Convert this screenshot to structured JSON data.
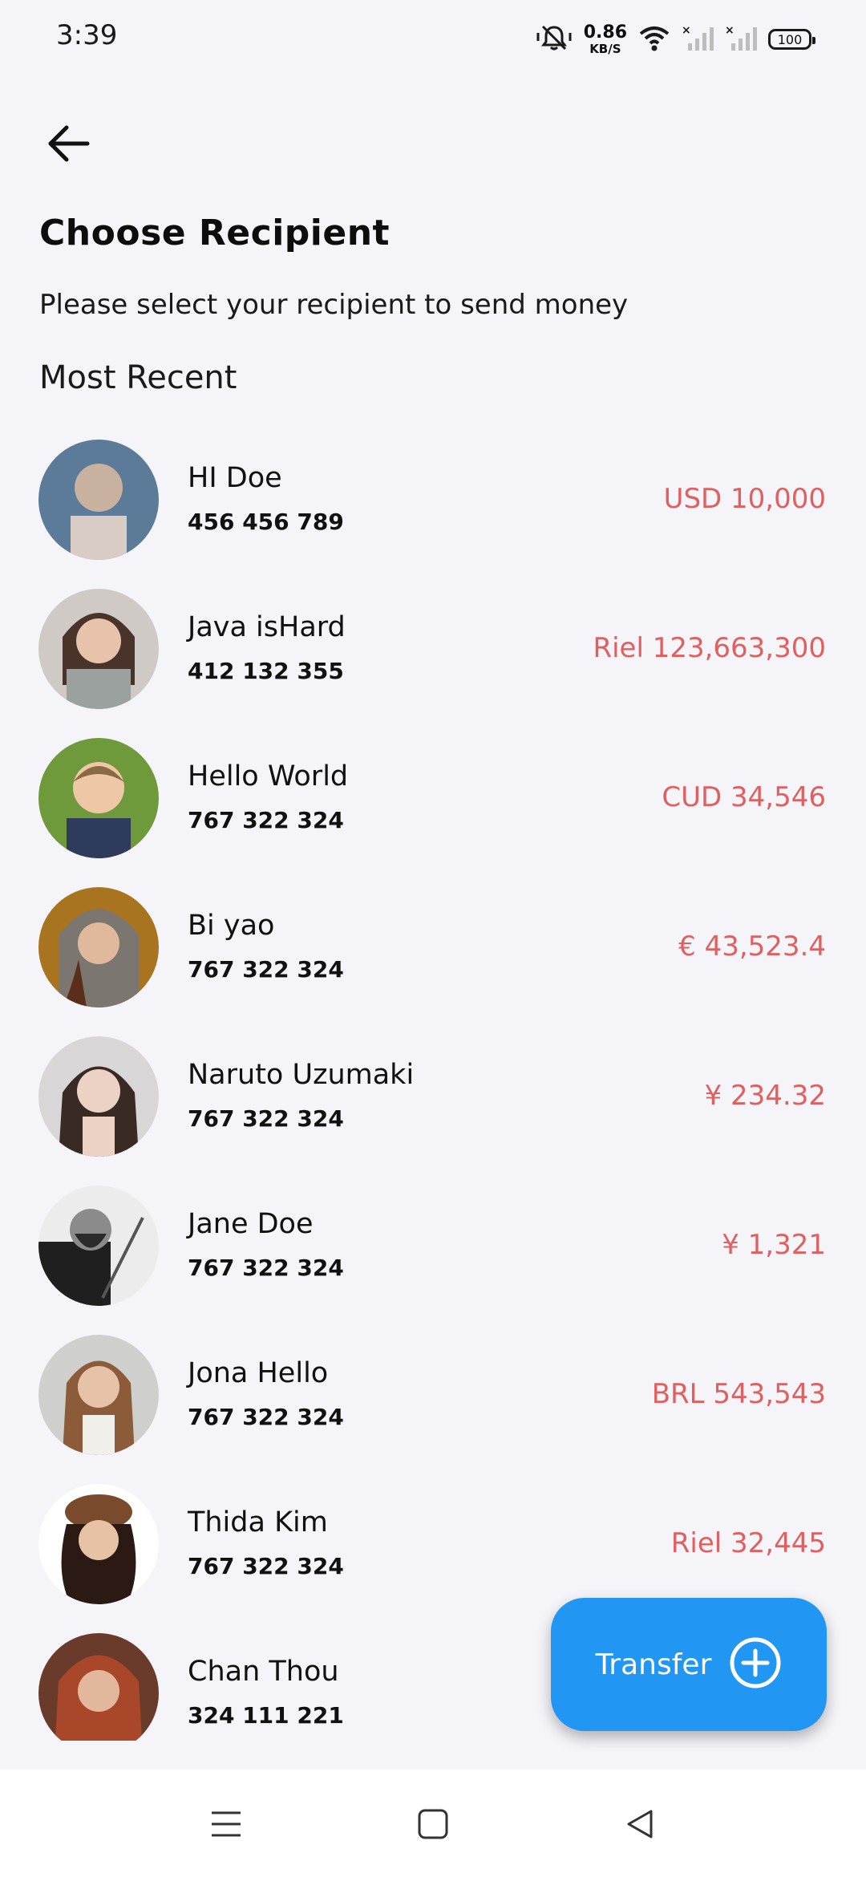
{
  "status_bar": {
    "time": "3:39",
    "net_speed_value": "0.86",
    "net_speed_unit": "KB/S",
    "battery": "100"
  },
  "header": {
    "title": "Choose Recipient",
    "subtitle": "Please select your recipient to send money",
    "section": "Most Recent"
  },
  "recipients": [
    {
      "name": "HI Doe",
      "phone": "456 456 789",
      "amount": "USD 10,000"
    },
    {
      "name": "Java isHard",
      "phone": "412 132 355",
      "amount": "Riel 123,663,300"
    },
    {
      "name": "Hello World",
      "phone": "767 322 324",
      "amount": "CUD 34,546"
    },
    {
      "name": "Bi yao",
      "phone": "767 322 324",
      "amount": "€ 43,523.4"
    },
    {
      "name": "Naruto Uzumaki",
      "phone": "767 322 324",
      "amount": "¥ 234.32"
    },
    {
      "name": "Jane Doe",
      "phone": "767 322 324",
      "amount": "¥ 1,321"
    },
    {
      "name": "Jona Hello",
      "phone": "767 322 324",
      "amount": "BRL 543,543"
    },
    {
      "name": "Thida Kim",
      "phone": "767 322 324",
      "amount": "Riel 32,445"
    },
    {
      "name": "Chan Thou",
      "phone": "324 111 221",
      "amount": ""
    }
  ],
  "fab": {
    "label": "Transfer",
    "icon": "plus-circle-icon"
  },
  "colors": {
    "accent": "#2196f3",
    "amount": "#e0605f",
    "background": "#f4f4f9"
  }
}
